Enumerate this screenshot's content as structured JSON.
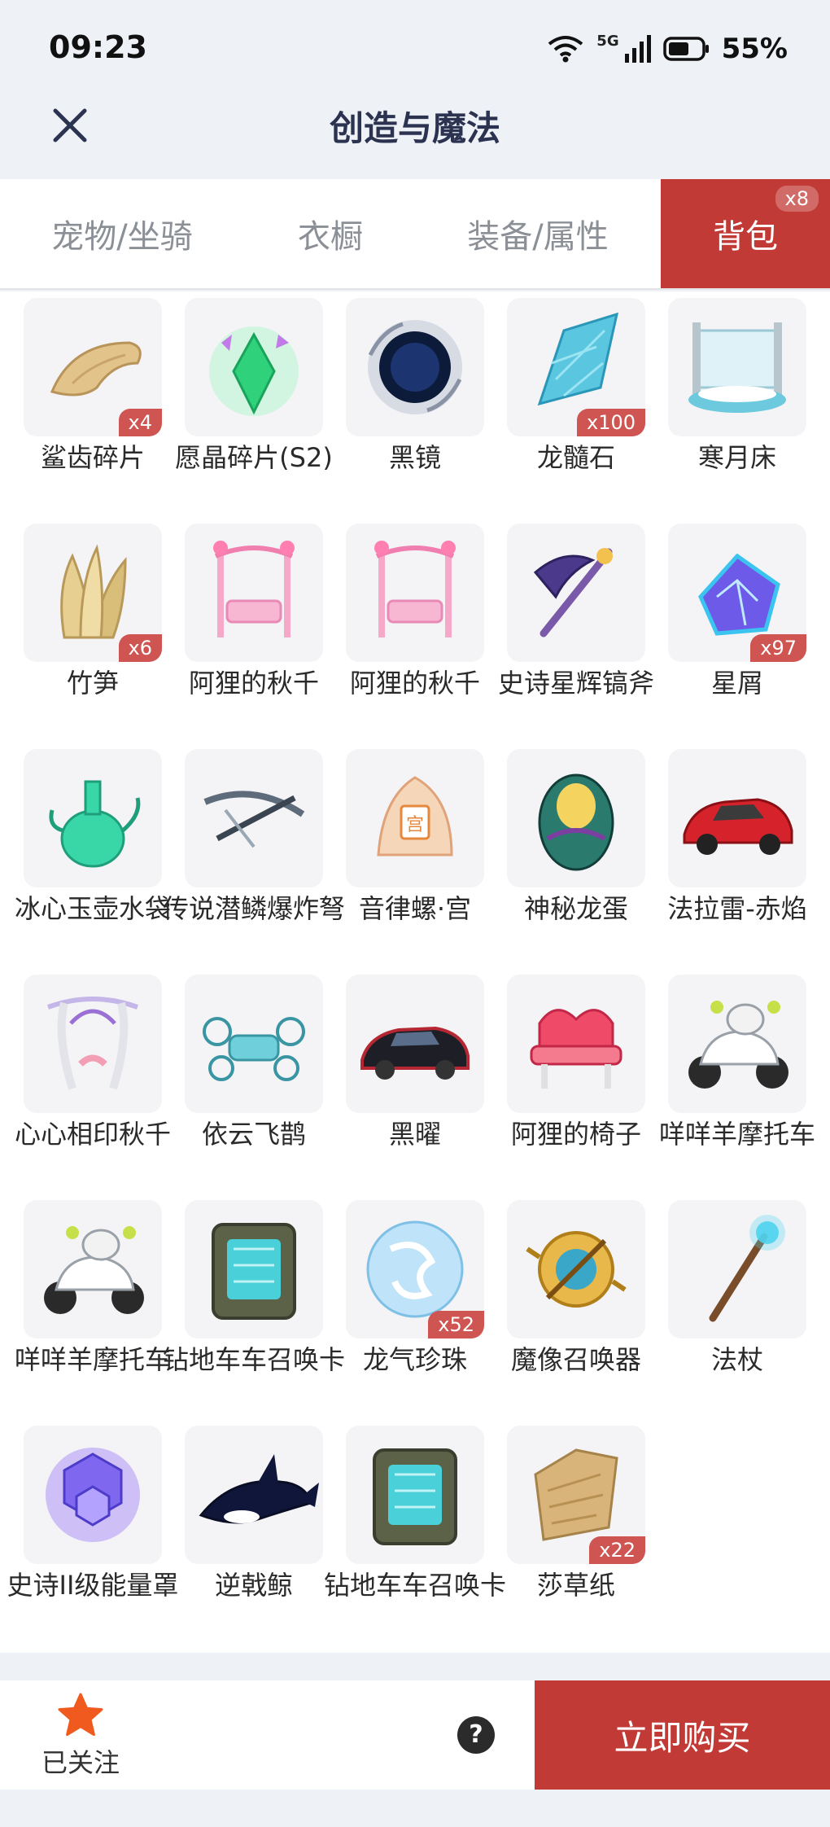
{
  "status": {
    "time": "09:23",
    "network": "5G",
    "battery": "55%"
  },
  "header": {
    "title": "创造与魔法"
  },
  "tabs": [
    {
      "label": "宠物/坐骑",
      "active": false
    },
    {
      "label": "衣橱",
      "active": false
    },
    {
      "label": "装备/属性",
      "active": false
    },
    {
      "label": "背包",
      "active": true,
      "badge": "x8"
    }
  ],
  "items": [
    {
      "name": "鲨齿碎片",
      "qty": "x4",
      "icon": "shark-tooth-fragment"
    },
    {
      "name": "愿晶碎片(S2)",
      "qty": "",
      "icon": "wish-crystal-fragment"
    },
    {
      "name": "黑镜",
      "qty": "",
      "icon": "black-mirror"
    },
    {
      "name": "龙髓石",
      "qty": "x100",
      "icon": "dragon-marrow-stone"
    },
    {
      "name": "寒月床",
      "qty": "",
      "icon": "cold-moon-bed"
    },
    {
      "name": "竹笋",
      "qty": "x6",
      "icon": "bamboo-shoot"
    },
    {
      "name": "阿狸的秋千",
      "qty": "",
      "icon": "ahri-swing"
    },
    {
      "name": "阿狸的秋千",
      "qty": "",
      "icon": "ahri-swing"
    },
    {
      "name": "史诗星辉镐斧",
      "qty": "",
      "icon": "epic-star-pickaxe"
    },
    {
      "name": "星屑",
      "qty": "x97",
      "icon": "stardust"
    },
    {
      "name": "冰心玉壶水袋",
      "qty": "",
      "icon": "jade-water-pot"
    },
    {
      "name": "传说潜鳞爆炸弩",
      "qty": "",
      "icon": "legend-crossbow"
    },
    {
      "name": "音律螺·宫",
      "qty": "",
      "icon": "melody-conch"
    },
    {
      "name": "神秘龙蛋",
      "qty": "",
      "icon": "mystery-dragon-egg"
    },
    {
      "name": "法拉雷-赤焰",
      "qty": "",
      "icon": "red-sports-car"
    },
    {
      "name": "心心相印秋千",
      "qty": "",
      "icon": "heart-swing"
    },
    {
      "name": "依云飞鹊",
      "qty": "",
      "icon": "cloud-drone"
    },
    {
      "name": "黑曜",
      "qty": "",
      "icon": "black-car"
    },
    {
      "name": "阿狸的椅子",
      "qty": "",
      "icon": "ahri-chair"
    },
    {
      "name": "咩咩羊摩托车",
      "qty": "",
      "icon": "sheep-motorbike"
    },
    {
      "name": "咩咩羊摩托车",
      "qty": "",
      "icon": "sheep-motorbike"
    },
    {
      "name": "钻地车车召唤卡",
      "qty": "",
      "icon": "drill-car-card"
    },
    {
      "name": "龙气珍珠",
      "qty": "x52",
      "icon": "dragon-pearl"
    },
    {
      "name": "魔像召唤器",
      "qty": "",
      "icon": "golem-summoner"
    },
    {
      "name": "法杖",
      "qty": "",
      "icon": "magic-staff"
    },
    {
      "name": "史诗II级能量罩",
      "qty": "",
      "icon": "energy-shield"
    },
    {
      "name": "逆戟鲸",
      "qty": "",
      "icon": "orca"
    },
    {
      "name": "钻地车车召唤卡",
      "qty": "",
      "icon": "drill-car-card"
    },
    {
      "name": "莎草纸",
      "qty": "x22",
      "icon": "papyrus"
    }
  ],
  "bottom": {
    "follow_label": "已关注",
    "help": "?",
    "buy_label": "立即购买"
  },
  "colors": {
    "accent": "#c23a35",
    "badge": "#cf5552",
    "follow_star": "#f05a1e"
  }
}
